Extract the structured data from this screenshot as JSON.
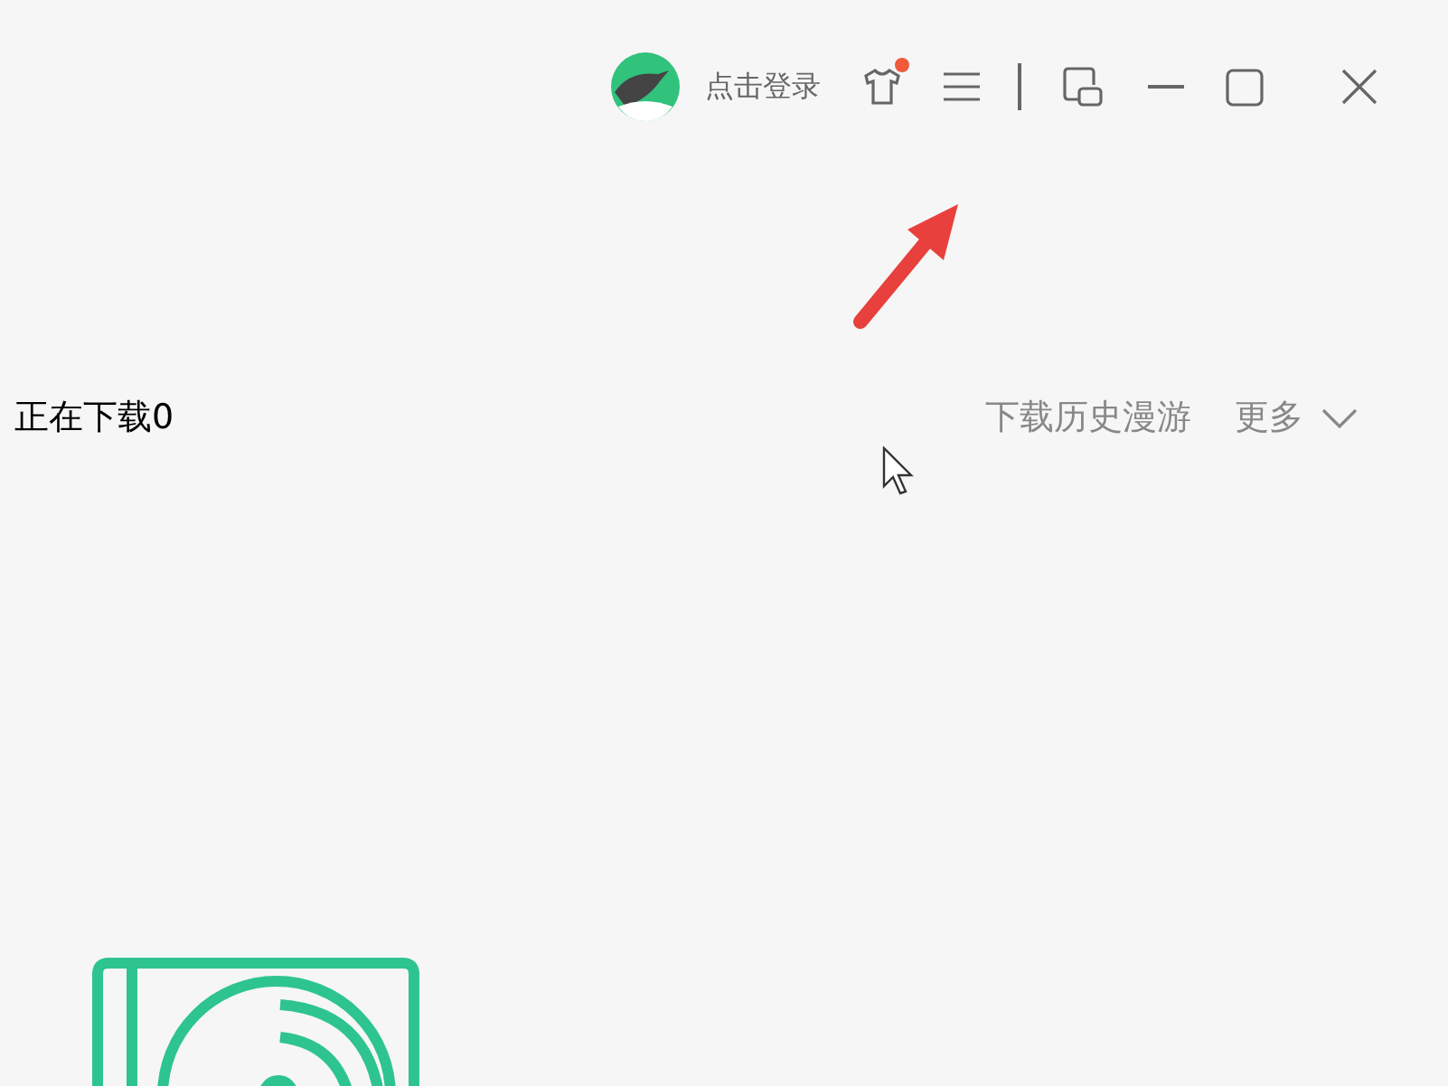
{
  "title_bar": {
    "login_label": "点击登录",
    "skin_notification": true
  },
  "download_bar": {
    "title": "正在下载0",
    "links": [
      {
        "label": "下载历史漫游"
      },
      {
        "label": "更多"
      }
    ]
  }
}
